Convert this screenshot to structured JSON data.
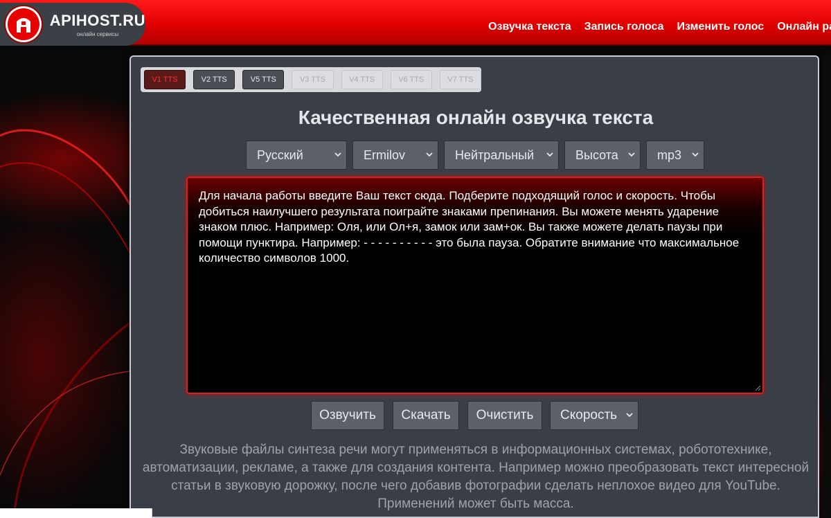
{
  "header": {
    "logo_title": "APIHOST.RU",
    "logo_subtitle": "онлайн сервисы",
    "nav": [
      "Озвучка текста",
      "Запись голоса",
      "Изменить голос",
      "Онлайн ра"
    ]
  },
  "tts_tabs": [
    {
      "label": "V1 TTS",
      "state": "active"
    },
    {
      "label": "V2 TTS",
      "state": "enabled"
    },
    {
      "label": "V5 TTS",
      "state": "enabled"
    },
    {
      "label": "V3 TTS",
      "state": "disabled"
    },
    {
      "label": "V4 TTS",
      "state": "disabled"
    },
    {
      "label": "V6 TTS",
      "state": "disabled"
    },
    {
      "label": "V7 TTS",
      "state": "disabled"
    }
  ],
  "title": "Качественная онлайн озвучка текста",
  "selects": {
    "language": "Русский",
    "voice": "Ermilov",
    "emotion": "Нейтральный",
    "pitch": "Высота",
    "format": "mp3"
  },
  "editor": {
    "text": "Для начала работы введите Ваш текст сюда. Подберите подходящий голос и скорость. Чтобы добиться наилучшего результата поиграйте знаками препинания. Вы можете менять ударение знаком плюс. Например: Оля, или Ол+я, замок или зам+ок. Вы также можете делать паузы при помощи пунктира. Например: - - - - - - - - - - это была пауза. Обратите внимание что максимальное количество символов 1000."
  },
  "actions": {
    "speak": "Озвучить",
    "download": "Скачать",
    "clear": "Очистить",
    "speed": "Скорость"
  },
  "description": "Звуковые файлы синтеза речи могут применяться в информационных системах, робототехнике, автоматизации, рекламе, а также для создания контента. Например можно преобразовать текст интересной статьи в звуковую дорожку, после чего добавив фотографии сделать неплохое видео для YouTube. Применений может быть масса.",
  "colors": {
    "header_red": "#e00000",
    "panel_bg": "#3a3f47",
    "accent_red": "#e21a1a"
  }
}
